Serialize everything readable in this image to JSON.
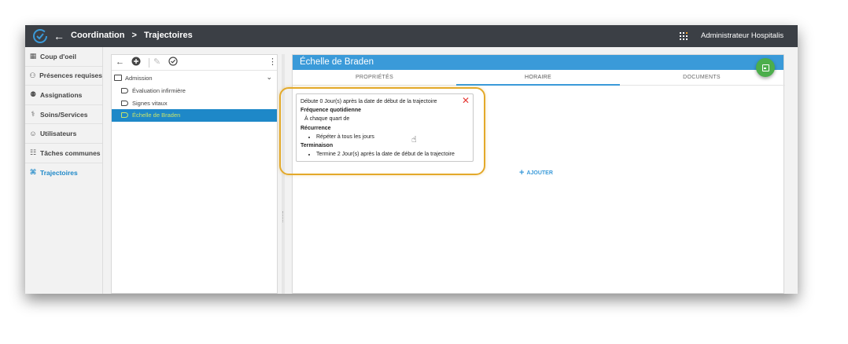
{
  "colors": {
    "topbar": "#3b3f45",
    "accent": "#3a9ad9",
    "save": "#4cae4c",
    "highlight": "#e3a92a",
    "close": "#e53935",
    "selected_text": "#c7e46b"
  },
  "header": {
    "breadcrumb": [
      "Coordination",
      "Trajectoires"
    ],
    "separator": ">",
    "user": "Administrateur Hospitalis",
    "icons": {
      "logo": "check-circle-icon",
      "back": "arrow-left-icon",
      "apps": "apps-grid-icon"
    }
  },
  "sidebar": {
    "items": [
      {
        "label": "Coup d'oeil",
        "icon": "dashboard-icon"
      },
      {
        "label": "Présences requises",
        "icon": "people-icon"
      },
      {
        "label": "Assignations",
        "icon": "assign-icon"
      },
      {
        "label": "Soins/Services",
        "icon": "care-icon"
      },
      {
        "label": "Utilisateurs",
        "icon": "user-icon"
      },
      {
        "label": "Tâches communes",
        "icon": "tasks-icon"
      },
      {
        "label": "Trajectoires",
        "icon": "trajectory-icon",
        "active": true
      }
    ]
  },
  "tree": {
    "root": "Admission",
    "items": [
      {
        "label": "Évaluation infirmière"
      },
      {
        "label": "Signes vitaux"
      },
      {
        "label": "Échelle de Braden",
        "selected": true
      }
    ]
  },
  "detail": {
    "title": "Échelle de Braden",
    "tabs": [
      "PROPRIÉTÉS",
      "HORAIRE",
      "DOCUMENTS"
    ],
    "active_tab": "HORAIRE",
    "schedule": {
      "start": "Débute 0 Jour(s) après la date de début de la trajectoire",
      "frequency_label": "Fréquence quotidienne",
      "frequency_value": "À chaque quart de",
      "recurrence_label": "Récurrence",
      "recurrence_value": "Répéter à tous les jours",
      "end_label": "Terminaison",
      "end_value": "Termine 2 Jour(s) après la date de début de la trajectoire"
    },
    "add_label": "AJOUTER"
  }
}
